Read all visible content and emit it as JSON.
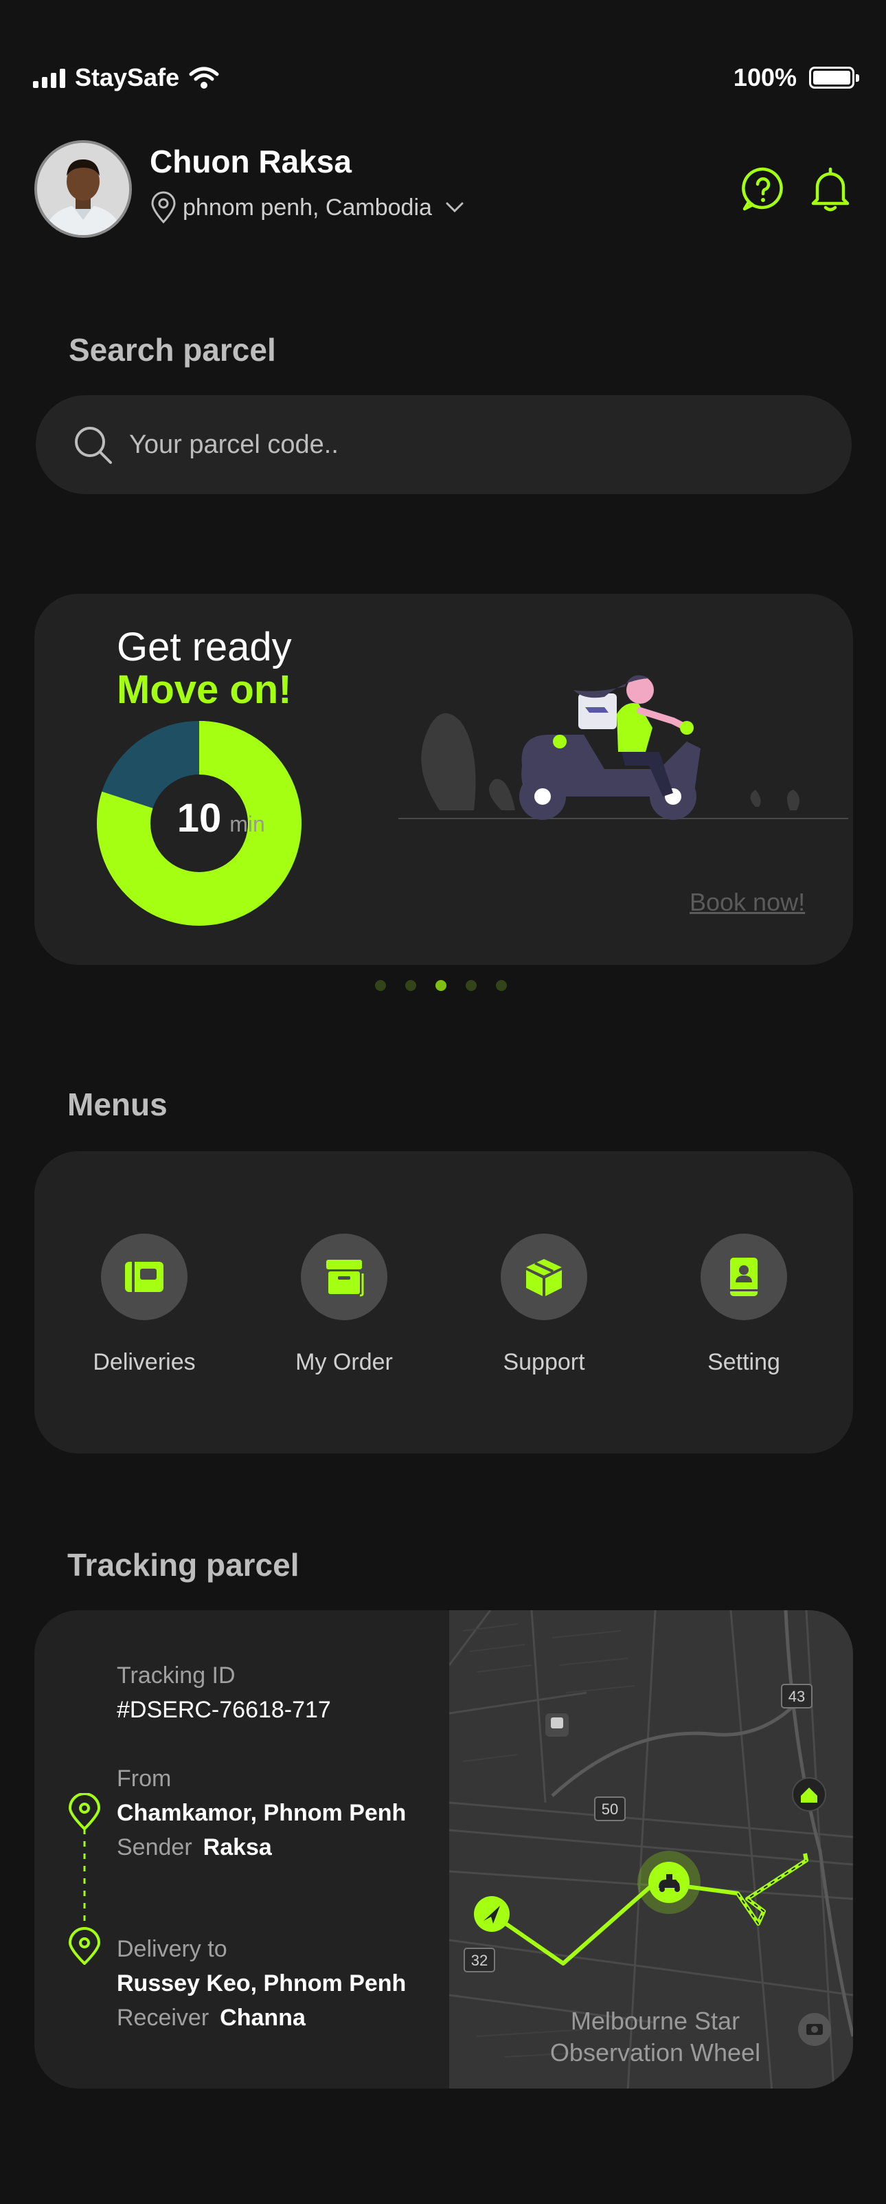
{
  "status_bar": {
    "carrier": "StaySafe",
    "battery": "100%"
  },
  "header": {
    "name": "Chuon Raksa",
    "location": "phnom penh, Cambodia"
  },
  "search": {
    "title": "Search parcel",
    "placeholder": "Your parcel code.."
  },
  "banner": {
    "title": "Get ready",
    "subtitle": "Move on!",
    "timer_value": "10",
    "timer_unit": "min",
    "timer_progress": 0.8,
    "cta": "Book now!",
    "page_index": 2,
    "page_count": 5
  },
  "menus": {
    "title": "Menus",
    "items": [
      {
        "label": "Deliveries",
        "icon": "deliveries-icon"
      },
      {
        "label": "My Order",
        "icon": "order-box-icon"
      },
      {
        "label": "Support",
        "icon": "support-box-icon"
      },
      {
        "label": "Setting",
        "icon": "setting-book-icon"
      }
    ]
  },
  "tracking": {
    "title": "Tracking parcel",
    "id_label": "Tracking ID",
    "id": "#DSERC-76618-717",
    "from_label": "From",
    "from": "Chamkamor, Phnom Penh",
    "sender_label": "Sender",
    "sender": "Raksa",
    "to_label": "Delivery to",
    "to": "Russey Keo, Phnom Penh",
    "receiver_label": "Receiver",
    "receiver": "Channa",
    "map": {
      "road_labels": [
        "43",
        "50",
        "32"
      ],
      "place_line1": "Melbourne Star",
      "place_line2": "Observation Wheel"
    }
  },
  "colors": {
    "accent": "#a4ff12",
    "background": "#131313",
    "card": "#222222",
    "donut_rest": "#1f4f63"
  }
}
